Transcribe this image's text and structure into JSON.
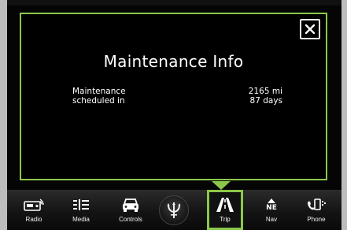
{
  "popup": {
    "title": "Maintenance Info",
    "label_line1": "Maintenance",
    "label_line2": "scheduled in",
    "miles": "2165 mi",
    "days": "87 days"
  },
  "navbar": {
    "items": [
      {
        "label": "Radio",
        "icon": "radio-icon"
      },
      {
        "label": "Media",
        "icon": "media-icon"
      },
      {
        "label": "Controls",
        "icon": "car-icon"
      },
      {
        "label": "Trip",
        "icon": "trip-road-icon",
        "active": true
      },
      {
        "label": "Nav",
        "icon": "compass-ne-icon",
        "compass": "NE"
      },
      {
        "label": "Phone",
        "icon": "phone-icon"
      }
    ]
  },
  "colors": {
    "accent": "#8bc74a",
    "screen_bg": "#050505",
    "text": "#ffffff"
  }
}
